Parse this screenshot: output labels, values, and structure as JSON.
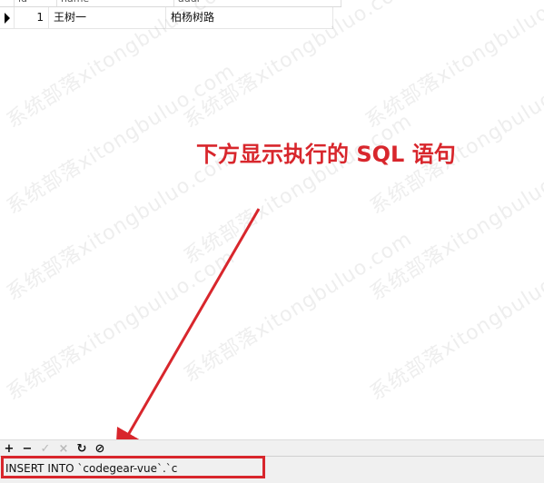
{
  "grid": {
    "columns": [
      "id",
      "name",
      "addr"
    ],
    "rows": [
      {
        "id": "1",
        "name": "王树一",
        "addr": "柏杨树路"
      }
    ]
  },
  "watermark": "系统部落xitongbuluo.com",
  "annotation": {
    "text": "下方显示执行的 SQL 语句",
    "color": "#d8262c"
  },
  "toolbar": {
    "add_icon": "+",
    "delete_icon": "−",
    "apply_icon": "✓",
    "discard_icon": "×",
    "refresh_icon": "↻",
    "stop_icon": "⊘"
  },
  "statusbar": {
    "sql": "INSERT INTO `codegear-vue`.`c"
  }
}
